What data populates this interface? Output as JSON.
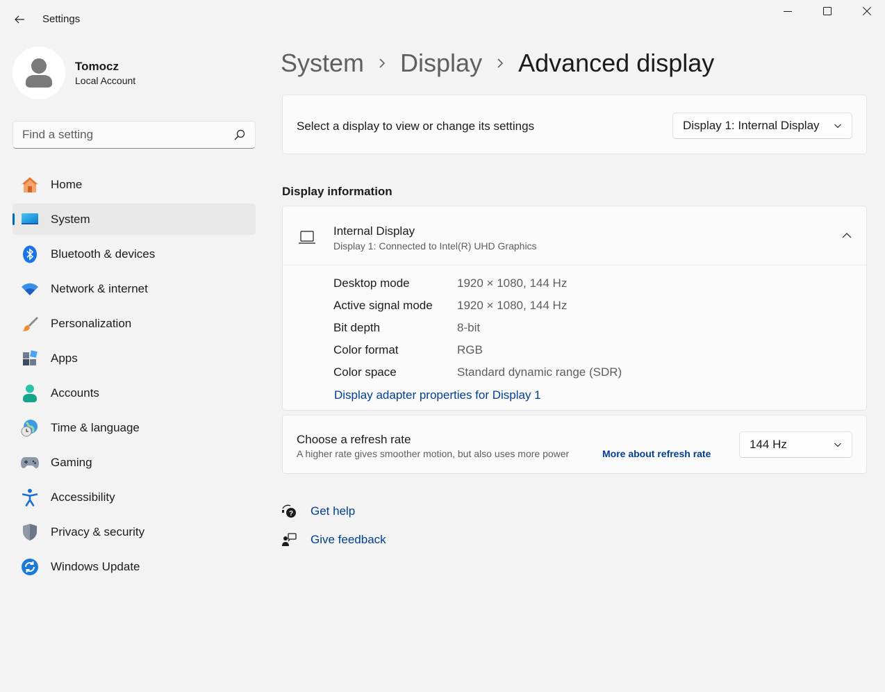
{
  "window": {
    "title": "Settings",
    "back_icon": "back-arrow-icon",
    "controls": [
      "minimize-icon",
      "maximize-icon",
      "close-icon"
    ]
  },
  "profile": {
    "name": "Tomocz",
    "account_type": "Local Account",
    "avatar_icon": "person-icon"
  },
  "search": {
    "placeholder": "Find a setting",
    "icon": "search-icon"
  },
  "sidebar": {
    "selected": "System",
    "items": [
      {
        "label": "Home",
        "icon": "home-icon"
      },
      {
        "label": "System",
        "icon": "system-icon"
      },
      {
        "label": "Bluetooth & devices",
        "icon": "bluetooth-icon"
      },
      {
        "label": "Network & internet",
        "icon": "wifi-icon"
      },
      {
        "label": "Personalization",
        "icon": "brush-icon"
      },
      {
        "label": "Apps",
        "icon": "apps-icon"
      },
      {
        "label": "Accounts",
        "icon": "accounts-icon"
      },
      {
        "label": "Time & language",
        "icon": "globe-clock-icon"
      },
      {
        "label": "Gaming",
        "icon": "gamepad-icon"
      },
      {
        "label": "Accessibility",
        "icon": "accessibility-icon"
      },
      {
        "label": "Privacy & security",
        "icon": "shield-icon"
      },
      {
        "label": "Windows Update",
        "icon": "update-icon"
      }
    ]
  },
  "breadcrumb": {
    "items": [
      "System",
      "Display",
      "Advanced display"
    ]
  },
  "display_select": {
    "label": "Select a display to view or change its settings",
    "selected": "Display 1: Internal Display"
  },
  "display_info": {
    "section_title": "Display information",
    "title": "Internal Display",
    "subtitle": "Display 1: Connected to Intel(R) UHD Graphics",
    "expanded": true,
    "rows": [
      {
        "key": "Desktop mode",
        "value": "1920 × 1080, 144 Hz"
      },
      {
        "key": "Active signal mode",
        "value": "1920 × 1080, 144 Hz"
      },
      {
        "key": "Bit depth",
        "value": "8-bit"
      },
      {
        "key": "Color format",
        "value": "RGB"
      },
      {
        "key": "Color space",
        "value": "Standard dynamic range (SDR)"
      }
    ],
    "adapter_link": "Display adapter properties for Display 1"
  },
  "refresh_rate": {
    "title": "Choose a refresh rate",
    "description": "A higher rate gives smoother motion, but also uses more power",
    "link": "More about refresh rate",
    "selected": "144 Hz"
  },
  "help": {
    "get_help": "Get help",
    "give_feedback": "Give feedback"
  },
  "colors": {
    "accent": "#0067c0",
    "link": "#003e92",
    "background": "#f3f3f3",
    "card": "#fbfbfb"
  }
}
